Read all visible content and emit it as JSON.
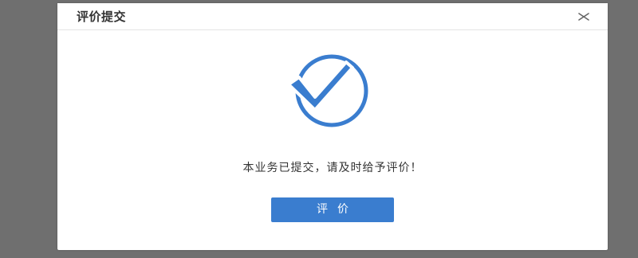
{
  "dialog": {
    "title": "评价提交",
    "close_icon": "close-icon",
    "success_icon": "check-circle-icon",
    "message": "本业务已提交，请及时给予评价！",
    "button_label": "评价"
  },
  "colors": {
    "overlay": "#6f6f6f",
    "accent": "#3a7dcf",
    "title_text": "#333333"
  }
}
